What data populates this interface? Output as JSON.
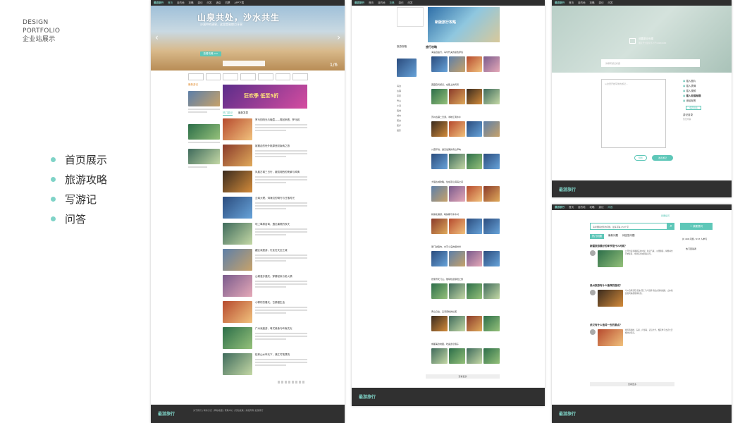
{
  "left": {
    "caption": [
      "DESIGN",
      "PORTFOLIO",
      "企业站展示"
    ],
    "menu": [
      {
        "label": "首页展示"
      },
      {
        "label": "旅游攻略"
      },
      {
        "label": "写游记"
      },
      {
        "label": "问答"
      }
    ]
  },
  "home": {
    "nav": [
      "最游旅行",
      "首页",
      "目的地",
      "攻略",
      "游记",
      "问答",
      "酒店",
      "机票",
      "APP下载"
    ],
    "hero_title": "山泉共处，沙水共生",
    "hero_sub": "沙漠中的清泉，这里是敦煌月牙泉",
    "hero_btn": "查看攻略 >>",
    "hero_counter": "1/6",
    "section_title": "最新游记",
    "banner_text": "狂欢季 低至5折",
    "tabs": [
      "热门游记",
      "最新发表"
    ],
    "articles": [
      "罗马的阳光与晚霞——再回来看，罗马城",
      "被搬走的世外桃源西双版纳之旅",
      "凤凰古城三日行，邂逅湘西的夜景与风情",
      "云南大理，洱海边的骑行与日落时光",
      "坝上草原自驾，遇见最美的秋天",
      "藏区深度游，行走在天空之城",
      "山城漫步重庆，穿楼轻轨与老火锅",
      "小寨村的春天，古镇慢生活",
      "广州深度游，粤式美食与岭南文化",
      "桂林山水甲天下，漓江竹筏漂流"
    ],
    "footer_logo": "最游旅行",
    "footer_text": "关于我们 | 联系方式 | 网站地图 | 帮助中心 | 隐私政策 | 版权所有 最游旅行"
  },
  "guide": {
    "nav": [
      "最游旅行",
      "首页",
      "目的地",
      "攻略",
      "游记",
      "问答"
    ],
    "side_title": "旅游攻略",
    "side_items": [
      "海边",
      "古镇",
      "草原",
      "雪山",
      "沙漠",
      "森林",
      "城市",
      "美食",
      "徒步",
      "摄影"
    ],
    "hero_text": "新版旅行攻略",
    "feed_title": "旅行攻略",
    "posts": [
      "海岛自由行，马尔代夫的蓝色梦境",
      "西藏自驾游记，在路上的风景",
      "苏州古镇二日游，寻味江南水乡",
      "川西环线，遇见最美的雪山草甸",
      "大理古城攻略，住在苍山洱海之间",
      "新疆北疆游，喀纳斯与禾木村",
      "厦门鼓浪屿，文艺小岛的慢时光",
      "张家界天门山，玻璃栈道惊险之旅",
      "黄山日出，云海奇松的壮美",
      "成都美食地图，吃遍宽窄巷子"
    ],
    "more": "查看更多",
    "footer_logo": "最游旅行"
  },
  "write": {
    "nav": [
      "最游旅行",
      "首页",
      "目的地",
      "攻略",
      "游记",
      "问答"
    ],
    "cover_label": "设置游记头图",
    "cover_hint": "图片尺寸建议不小于1920x600",
    "title_placeholder": "请填写游记标题",
    "body_placeholder": "从这里开始写你的游记...",
    "tools": [
      "插入图片",
      "插入表情",
      "插入视频",
      "插入段落标题",
      "添加标签"
    ],
    "tools_btn": "保存草稿",
    "draft_title": "游记目录",
    "draft_text": "暂无内容",
    "preview_btn": "预览",
    "publish_btn": "发表游记",
    "footer_logo": "最游旅行"
  },
  "qa": {
    "nav": [
      "最游旅行",
      "首页",
      "目的地",
      "攻略",
      "游记",
      "问答"
    ],
    "header_link": "我要提问",
    "search_placeholder": "请详细描述您的问题，最多可输入50个字",
    "ask_btn": "+ 我要提问",
    "tabs": [
      "热门问题",
      "最新问题",
      "待回答问题"
    ],
    "stats": "共 496 问题 / 197 人参与",
    "expert_label": "热门回答者",
    "questions": [
      {
        "title": "新疆旅游最好的季节是什么时候？",
        "answer": "九月份是新疆最美的时候，秋高气爽，瓜果飘香，胡杨林也开始变黄，非常适合拍照和自驾。"
      },
      {
        "title": "贵州旅游有什么推荐的路线？",
        "answer": "可以选择贵阳-荔波-西江千户苗寨-镇远古镇的线路，山水和民族风情都能体验到。"
      },
      {
        "title": "武汉有什么值得一去的景点？",
        "answer": "推荐黄鹤楼、东湖、户部巷、武汉大学，樱花季节去武大赏樱非常漂亮。"
      }
    ],
    "more": "查看更多",
    "footer_logo": "最游旅行"
  },
  "colors": {
    "accent": "#5ec7b8",
    "dark": "#2f2f2f",
    "footer": "#303030"
  }
}
